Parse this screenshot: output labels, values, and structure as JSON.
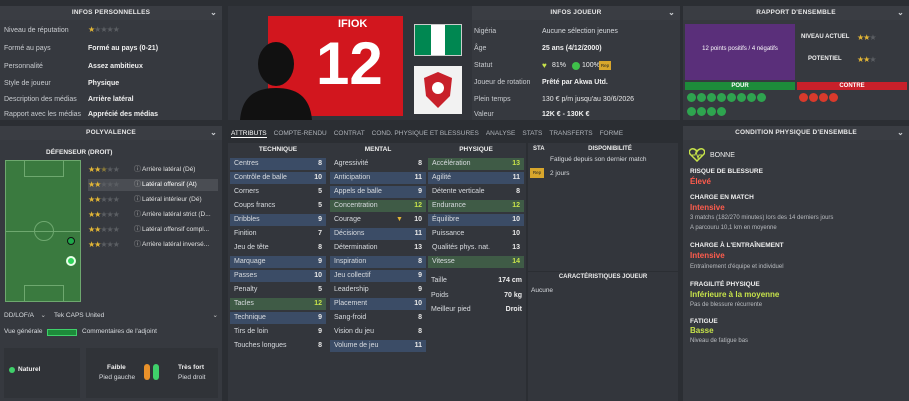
{
  "personal": {
    "header": "INFOS PERSONNELLES",
    "rows": [
      {
        "label": "Niveau de réputation",
        "value": "",
        "stars": 1
      },
      {
        "label": "Formé au pays",
        "value": "Formé au pays (0-21)"
      },
      {
        "label": "Personnalité",
        "value": "Assez ambitieux"
      },
      {
        "label": "Style de joueur",
        "value": "Physique"
      },
      {
        "label": "Description des médias",
        "value": "Arrière latéral"
      },
      {
        "label": "Rapport avec les médias",
        "value": "Apprécié des médias"
      }
    ]
  },
  "player": {
    "name": "IFIOK",
    "number": "12",
    "accent": "#d2161e"
  },
  "info": {
    "header": "INFOS JOUEUR",
    "rows": [
      {
        "label": "Nigéria",
        "value": "Aucune sélection jeunes"
      },
      {
        "label": "Âge",
        "value": "25 ans (4/12/2000)"
      },
      {
        "label": "Statut",
        "fitness": "81%",
        "condition": "100%",
        "badge": "Rep"
      },
      {
        "label": "Joueur de rotation",
        "value": "Prêté par Akwa Utd."
      },
      {
        "label": "Plein temps",
        "value": "130 € p/m jusqu'au 30/6/2026"
      },
      {
        "label": "Valeur",
        "value": "12K € - 130K €"
      }
    ]
  },
  "report": {
    "header": "RAPPORT D'ENSEMBLE",
    "summary": "12 points positifs / 4 négatifs",
    "current_label": "NIVEAU ACTUEL",
    "potential_label": "POTENTIEL",
    "pour": "POUR",
    "contre": "CONTRE"
  },
  "tabs": [
    {
      "label": "ATTRIBUTS",
      "active": true
    },
    {
      "label": "COMPTE-RENDU"
    },
    {
      "label": "CONTRAT"
    },
    {
      "label": "COND. PHYSIQUE ET BLESSURES"
    },
    {
      "label": "ANALYSE"
    },
    {
      "label": "STATS"
    },
    {
      "label": "TRANSFERTS"
    },
    {
      "label": "FORME"
    }
  ],
  "versatility": {
    "header": "POLYVALENCE",
    "position": "DÉFENSEUR (DROIT)",
    "roles": [
      {
        "stars": 2.5,
        "name": "Arrière latéral (Dé)"
      },
      {
        "stars": 2,
        "name": "Latéral offensif (At)",
        "sel": true
      },
      {
        "stars": 2,
        "name": "Latéral intérieur (Dé)"
      },
      {
        "stars": 2,
        "name": "Arrière latéral strict (D..."
      },
      {
        "stars": 2,
        "name": "Latéral offensif compl..."
      },
      {
        "stars": 2,
        "name": "Arrière latéral inversé..."
      }
    ],
    "formation": "DD/LOF/A",
    "club": "Tek CAPS United",
    "overview": "Vue générale",
    "comments": "Commentaires de l'adjoint"
  },
  "technique": {
    "header": "TECHNIQUE",
    "items": [
      {
        "n": "Centres",
        "v": "8"
      },
      {
        "n": "Contrôle de balle",
        "v": "10"
      },
      {
        "n": "Corners",
        "v": "5"
      },
      {
        "n": "Coups francs",
        "v": "5"
      },
      {
        "n": "Dribbles",
        "v": "9"
      },
      {
        "n": "Finition",
        "v": "7"
      },
      {
        "n": "Jeu de tête",
        "v": "8"
      },
      {
        "n": "Marquage",
        "v": "9"
      },
      {
        "n": "Passes",
        "v": "10"
      },
      {
        "n": "Penalty",
        "v": "5"
      },
      {
        "n": "Tacles",
        "v": "12"
      },
      {
        "n": "Technique",
        "v": "9"
      },
      {
        "n": "Tirs de loin",
        "v": "9"
      },
      {
        "n": "Touches longues",
        "v": "8"
      }
    ]
  },
  "mental": {
    "header": "MENTAL",
    "items": [
      {
        "n": "Agressivité",
        "v": "8"
      },
      {
        "n": "Anticipation",
        "v": "11"
      },
      {
        "n": "Appels de balle",
        "v": "9"
      },
      {
        "n": "Concentration",
        "v": "12"
      },
      {
        "n": "Courage",
        "v": "10"
      },
      {
        "n": "Décisions",
        "v": "11"
      },
      {
        "n": "Détermination",
        "v": "13"
      },
      {
        "n": "Inspiration",
        "v": "8"
      },
      {
        "n": "Jeu collectif",
        "v": "9"
      },
      {
        "n": "Leadership",
        "v": "9"
      },
      {
        "n": "Placement",
        "v": "10"
      },
      {
        "n": "Sang-froid",
        "v": "8"
      },
      {
        "n": "Vision du jeu",
        "v": "8"
      },
      {
        "n": "Volume de jeu",
        "v": "11"
      }
    ]
  },
  "physique": {
    "header": "PHYSIQUE",
    "items": [
      {
        "n": "Accélération",
        "v": "13"
      },
      {
        "n": "Agilité",
        "v": "11"
      },
      {
        "n": "Détente verticale",
        "v": "8"
      },
      {
        "n": "Endurance",
        "v": "12"
      },
      {
        "n": "Équilibre",
        "v": "10"
      },
      {
        "n": "Puissance",
        "v": "10"
      },
      {
        "n": "Qualités phys. nat.",
        "v": "13"
      },
      {
        "n": "Vitesse",
        "v": "14"
      }
    ],
    "height_label": "Taille",
    "height": "174 cm",
    "weight_label": "Poids",
    "weight": "70 kg",
    "foot_label": "Meilleur pied",
    "foot": "Droit"
  },
  "availability": {
    "sta": "STA",
    "header": "DISPONIBILITÉ",
    "text1": "Fatigué depuis son dernier match",
    "text2": "2 jours",
    "badge": "Rep"
  },
  "characteristics": {
    "header": "CARACTÉRISTIQUES JOUEUR",
    "value": "Aucune"
  },
  "condition": {
    "header": "CONDITION PHYSIQUE D'ENSEMBLE",
    "overall": "BONNE",
    "blocks": [
      {
        "t": "RISQUE DE BLESSURE",
        "v": "Élevé",
        "c": "#ff5c4d",
        "s": ""
      },
      {
        "t": "CHARGE EN MATCH",
        "v": "Intensive",
        "c": "#ff5c4d",
        "s": "3 matchs (182/270 minutes) lors des 14 derniers jours",
        "s2": "A parcouru 10,1 km en moyenne"
      },
      {
        "t": "CHARGE À L'ENTRAÎNEMENT",
        "v": "Intensive",
        "c": "#ff5c4d",
        "s": "Entraînement d'équipe et individuel"
      },
      {
        "t": "FRAGILITÉ PHYSIQUE",
        "v": "Inférieure à la moyenne",
        "c": "#c7e34a",
        "s": "Pas de blessure récurrente"
      },
      {
        "t": "FATIGUE",
        "v": "Basse",
        "c": "#c7e34a",
        "s": "Niveau de fatigue bas"
      }
    ]
  },
  "feet": {
    "condition": "Naturel",
    "weak": "Faible",
    "weak_sub": "Pied gauche",
    "strong": "Très fort",
    "strong_sub": "Pied droit"
  }
}
